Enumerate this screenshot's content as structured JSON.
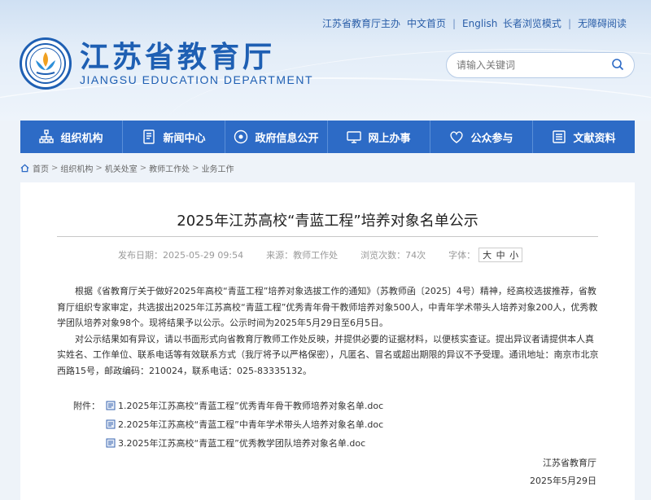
{
  "topbar": {
    "host": "江苏省教育厅主办",
    "home": "中文首页",
    "english": "English",
    "elder": "长者浏览模式",
    "barrier_free": "无障碍阅读"
  },
  "brand": {
    "cn": "江苏省教育厅",
    "en": "JIANGSU EDUCATION DEPARTMENT"
  },
  "search": {
    "placeholder": "请输入关键词"
  },
  "nav": {
    "items": [
      {
        "label": "组织机构",
        "icon": "org-chart-icon"
      },
      {
        "label": "新闻中心",
        "icon": "news-icon"
      },
      {
        "label": "政府信息公开",
        "icon": "info-public-icon"
      },
      {
        "label": "网上办事",
        "icon": "online-service-icon"
      },
      {
        "label": "公众参与",
        "icon": "heart-icon"
      },
      {
        "label": "文献资料",
        "icon": "documents-icon"
      }
    ]
  },
  "breadcrumb": [
    "首页",
    "组织机构",
    "机关处室",
    "教师工作处",
    "业务工作"
  ],
  "article": {
    "title": "2025年江苏高校“青蓝工程”培养对象名单公示",
    "date_label": "发布日期：",
    "date": "2025-05-29 09:54",
    "source_label": "来源：",
    "source": "教师工作处",
    "views_label": "浏览次数：",
    "views": "74次",
    "font_label": "字体：",
    "font_sizes": [
      "大",
      "中",
      "小"
    ],
    "para1": "根据《省教育厅关于做好2025年高校“青蓝工程”培养对象选拔工作的通知》（苏教师函〔2025〕4号）精神，经高校选拔推荐，省教育厅组织专家审定，共选拔出2025年江苏高校“青蓝工程”优秀青年骨干教师培养对象500人，中青年学术带头人培养对象200人，优秀教学团队培养对象98个。现将结果予以公示。公示时间为2025年5月29日至6月5日。",
    "para2": "对公示结果如有异议，请以书面形式向省教育厅教师工作处反映，并提供必要的证据材料，以便核实查证。提出异议者请提供本人真实姓名、工作单位、联系电话等有效联系方式（我厅将予以严格保密），凡匿名、冒名或超出期限的异议不予受理。通讯地址：南京市北京西路15号，邮政编码：210024，联系电话：025-83335132。",
    "attach_label": "附件：",
    "attachments": [
      "1.2025年江苏高校“青蓝工程”优秀青年骨干教师培养对象名单.doc",
      "2.2025年江苏高校“青蓝工程”中青年学术带头人培养对象名单.doc",
      "3.2025年江苏高校“青蓝工程”优秀教学团队培养对象名单.doc"
    ],
    "signer": "江苏省教育厅",
    "sign_date": "2025年5月29日"
  }
}
